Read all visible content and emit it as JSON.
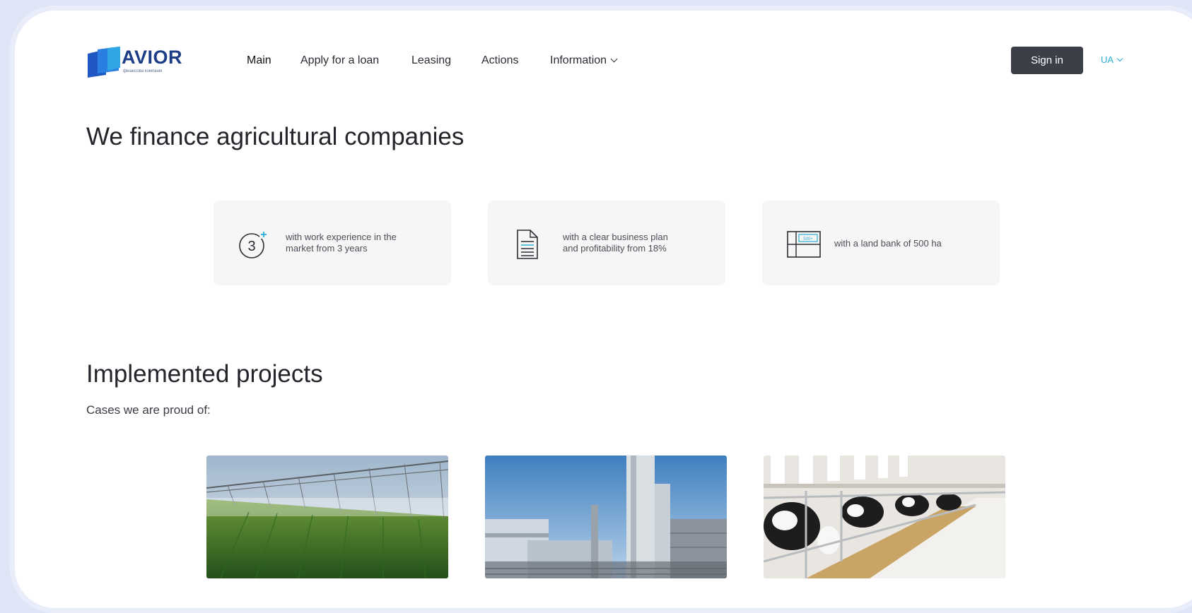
{
  "header": {
    "logo_text": "AVIOR",
    "logo_sub": "фінансова компанія",
    "nav": [
      {
        "label": "Main"
      },
      {
        "label": "Apply for a loan"
      },
      {
        "label": "Leasing"
      },
      {
        "label": "Actions"
      },
      {
        "label": "Information"
      }
    ],
    "sign_in": "Sign in",
    "language": "UA"
  },
  "hero": {
    "title": "We finance agricultural companies"
  },
  "criteria": [
    {
      "icon": "three-years-icon",
      "line1": "with work experience in the",
      "line2": "market from 3 years"
    },
    {
      "icon": "business-plan-document-icon",
      "line1": "with a clear business plan",
      "line2": "and profitability from 18%"
    },
    {
      "icon": "land-plot-icon",
      "line1": "with a land bank of 500 ha",
      "line2": "",
      "icon_label": "500+"
    }
  ],
  "projects": {
    "title": "Implemented projects",
    "subtitle": "Cases we are proud of:",
    "images": [
      "irrigation-field-photo",
      "industrial-plant-photo",
      "dairy-farm-cows-photo"
    ]
  },
  "colors": {
    "accent": "#2ab0d6",
    "brand_dark": "#1c3d86",
    "button_bg": "#3b3f47",
    "page_bg": "#dfe5f6"
  }
}
